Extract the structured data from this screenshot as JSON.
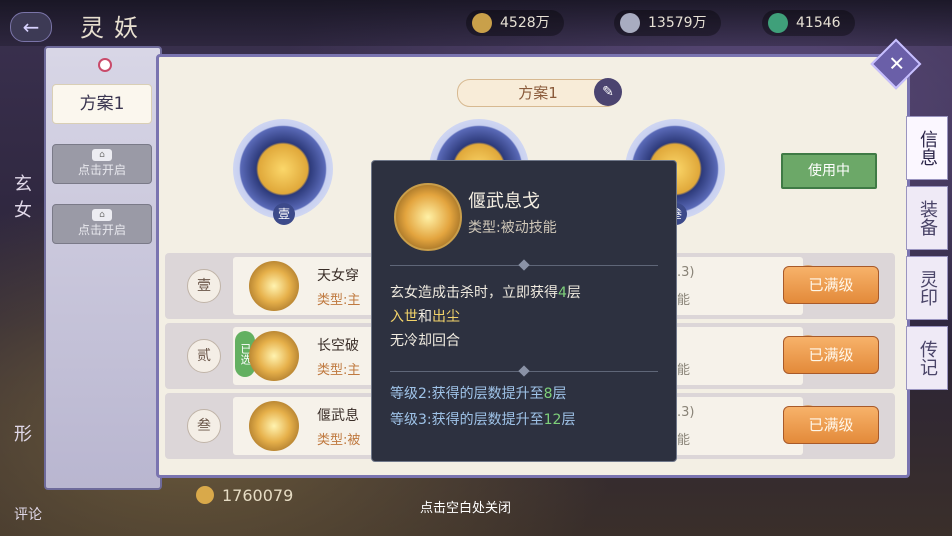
{
  "top_bar": {
    "back_icon": "back-arrow-icon",
    "title": "灵妖",
    "resources": [
      {
        "icon": "copper-coin-icon",
        "value": "4528万"
      },
      {
        "icon": "silver-feather-icon",
        "value": "13579万"
      },
      {
        "icon": "jade-icon",
        "value": "41546"
      }
    ]
  },
  "sidebar": {
    "plans": [
      {
        "label": "方案1",
        "state": "active"
      },
      {
        "label": "点击开启",
        "state": "locked"
      },
      {
        "label": "点击开启",
        "state": "locked"
      }
    ],
    "left_text": {
      "a": "玄",
      "b": "女"
    }
  },
  "panel": {
    "header": "方案1",
    "slots": [
      "壹",
      "贰",
      "叁"
    ],
    "in_use": "使用中",
    "rows": [
      {
        "num": "壹",
        "name": "天女穿",
        "type": "类型:主",
        "right_a": ".3)",
        "right_b": "能",
        "button": "已满级",
        "selected": false
      },
      {
        "num": "贰",
        "name": "长空破",
        "type": "类型:主",
        "right_a": "",
        "right_b": "能",
        "button": "已满级",
        "selected": true,
        "selected_label": "已选"
      },
      {
        "num": "叁",
        "name": "偃武息",
        "type": "类型:被",
        "right_a": ".3)",
        "right_b": "能",
        "button": "已满级",
        "selected": false
      }
    ]
  },
  "side_tabs": [
    "信息",
    "装备",
    "灵印",
    "传记"
  ],
  "tooltip": {
    "name": "偃武息戈",
    "type": "类型:被动技能",
    "desc_pre": "玄女造成击杀时，立即获得",
    "desc_num": "4",
    "desc_mid": "层",
    "desc_k1": "入世",
    "desc_and": "和",
    "desc_k2": "出尘",
    "desc_line2": "无冷却回合",
    "lvl2_pre": "等级2:获得的层数提升至",
    "lvl2_num": "8",
    "lvl2_post": "层",
    "lvl3_pre": "等级3:获得的层数提升至",
    "lvl3_num": "12",
    "lvl3_post": "层"
  },
  "bottom": {
    "gold": "1760079",
    "close_hint": "点击空白处关闭",
    "comment": "评论",
    "left_char": "形"
  },
  "colors": {
    "accent": "#7a74b0",
    "button": "#e38a3a",
    "in_use": "#6ca868"
  }
}
